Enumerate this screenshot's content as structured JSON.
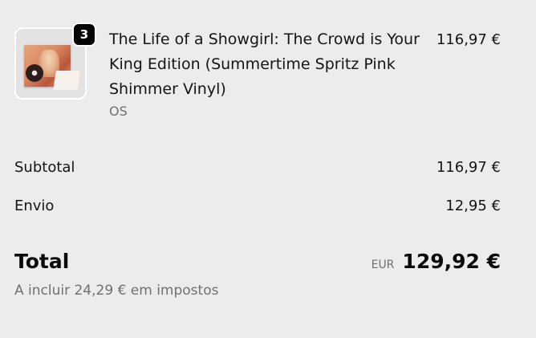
{
  "line_item": {
    "quantity": "3",
    "title": "The Life of a Showgirl: The Crowd is Your King Edition (Summertime Spritz Pink Shimmer Vinyl)",
    "variant": "OS",
    "price": "116,97 €",
    "image_icon": "product-thumbnail-icon"
  },
  "summary": {
    "subtotal_label": "Subtotal",
    "subtotal_value": "116,97 €",
    "shipping_label": "Envio",
    "shipping_value": "12,95 €",
    "total_label": "Total",
    "currency_code": "EUR",
    "total_value": "129,92 €",
    "tax_note": "A incluir 24,29 € em impostos"
  },
  "colors": {
    "background": "#ececec",
    "text_primary": "#141414",
    "text_secondary": "#707070",
    "badge_background": "#050505"
  }
}
